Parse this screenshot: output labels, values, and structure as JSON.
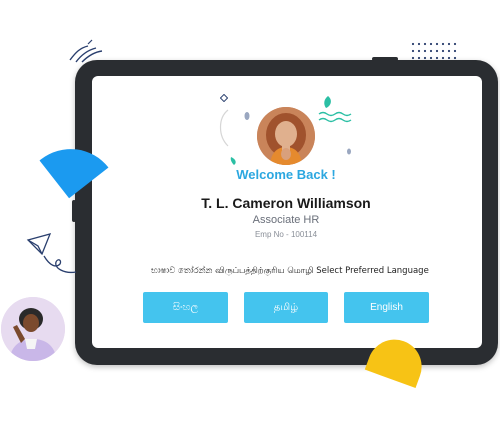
{
  "welcome": {
    "text": "Welcome Back !"
  },
  "user": {
    "name": "T. L. Cameron Williamson",
    "role": "Associate HR",
    "emp_no": "Emp No - 100114"
  },
  "language": {
    "prompt": "භාෂාව තෝරන්න விருப்பத்திற்குரிய மொழி Select Preferred Language",
    "options": [
      "සිංහල",
      "தமிழ்",
      "English"
    ]
  },
  "colors": {
    "accent": "#2ba7e0",
    "button": "#44c4ee",
    "tablet_frame": "#2a2d31",
    "decor_blue": "#1b9af0",
    "decor_yellow": "#f7c315"
  },
  "icons": [
    "paper-plane-icon",
    "doodle-lines-icon",
    "dot-grid-icon",
    "leaf-icon",
    "wave-icon",
    "diamond-icon"
  ]
}
